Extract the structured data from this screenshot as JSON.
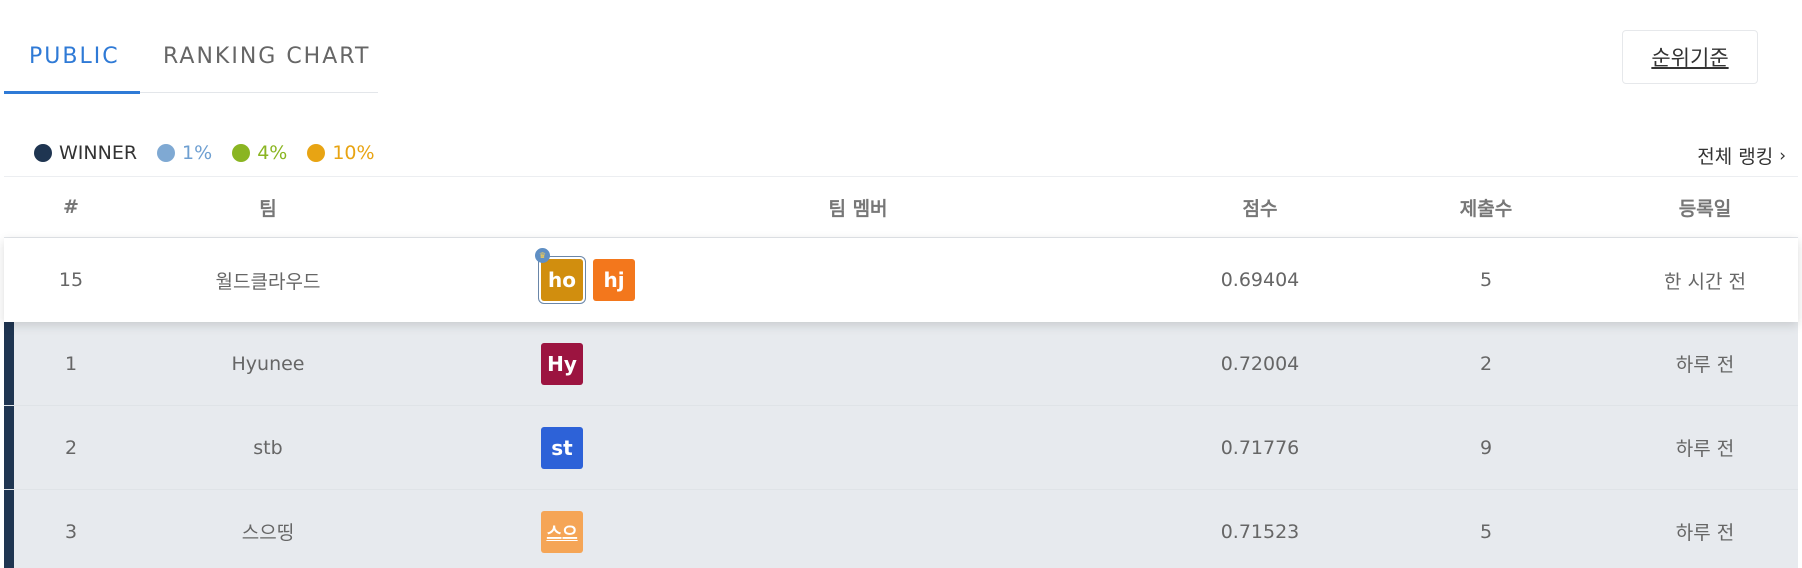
{
  "tabs": [
    {
      "label": "PUBLIC"
    },
    {
      "label": "RANKING CHART"
    }
  ],
  "criteria_button": "순위기준",
  "legend": [
    {
      "label": "WINNER",
      "color": "#1f3551",
      "text_color": "#333333"
    },
    {
      "label": "1%",
      "color": "#7fa9d3",
      "text_color": "#6e9fd1"
    },
    {
      "label": "4%",
      "color": "#8ab522",
      "text_color": "#8ab522"
    },
    {
      "label": "10%",
      "color": "#e8a413",
      "text_color": "#e8a413"
    }
  ],
  "full_ranking": {
    "label": "전체 랭킹",
    "icon": "chevron-right-icon"
  },
  "columns": {
    "rank": "#",
    "team": "팀",
    "members": "팀 멤버",
    "score": "점수",
    "submissions": "제출수",
    "date": "등록일"
  },
  "my_row": {
    "rank": "15",
    "team": "월드클라우드",
    "members": [
      {
        "initials": "ho",
        "color": "#d18e0e",
        "leader": true
      },
      {
        "initials": "hj",
        "color": "#f3771c",
        "leader": false
      }
    ],
    "score": "0.69404",
    "submissions": "5",
    "date": "한 시간 전"
  },
  "rows": [
    {
      "rank": "1",
      "team": "Hyunee",
      "members": [
        {
          "initials": "Hy",
          "color": "#9c1440"
        }
      ],
      "score": "0.72004",
      "submissions": "2",
      "date": "하루 전"
    },
    {
      "rank": "2",
      "team": "stb",
      "members": [
        {
          "initials": "st",
          "color": "#2d62d8"
        }
      ],
      "score": "0.71776",
      "submissions": "9",
      "date": "하루 전"
    },
    {
      "rank": "3",
      "team": "스으띵",
      "members": [
        {
          "initials": "스으",
          "color": "#f5a556"
        }
      ],
      "score": "0.71523",
      "submissions": "5",
      "date": "하루 전"
    }
  ]
}
